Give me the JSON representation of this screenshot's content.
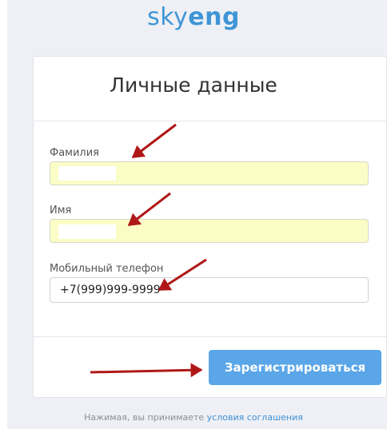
{
  "brand": {
    "sky": "sky",
    "eng": "eng"
  },
  "form": {
    "title": "Личные данные",
    "surname_label": "Фамилия",
    "surname_value": "",
    "name_label": "Имя",
    "name_value": "",
    "phone_label": "Мобильный телефон",
    "phone_value": "+7(999)999-9999",
    "submit_label": "Зарегистрироваться"
  },
  "footer": {
    "text": "Нажимая, вы принимаете ",
    "link": "условия соглашения"
  },
  "colors": {
    "accent": "#5aa6e9",
    "autofill": "#fbfdc6",
    "annotation_arrow": "#b01818"
  },
  "annotations": {
    "arrow_icon": "red-arrow-icon"
  }
}
